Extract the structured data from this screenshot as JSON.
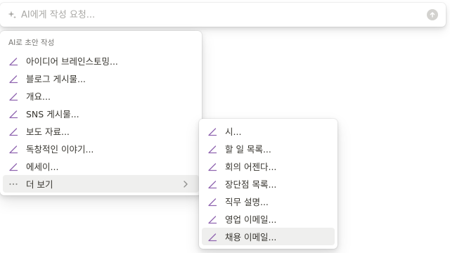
{
  "ai_bar": {
    "placeholder": "AI에게 작성 요청..."
  },
  "main_menu": {
    "section_title": "AI로 초안 작성",
    "items": [
      {
        "label": "아이디어 브레인스토밍..."
      },
      {
        "label": "블로그 게시물..."
      },
      {
        "label": "개요..."
      },
      {
        "label": "SNS 게시물..."
      },
      {
        "label": "보도 자료..."
      },
      {
        "label": "독창적인 이야기..."
      },
      {
        "label": "에세이..."
      }
    ],
    "more": {
      "label": "더 보기"
    }
  },
  "sub_menu": {
    "items": [
      {
        "label": "시..."
      },
      {
        "label": "할 일 목록..."
      },
      {
        "label": "회의 어젠다..."
      },
      {
        "label": "장단점 목록..."
      },
      {
        "label": "직무 설명..."
      },
      {
        "label": "영업 이메일..."
      },
      {
        "label": "채용 이메일..."
      }
    ]
  },
  "colors": {
    "accent_purple": "#9065b0",
    "text": "#37352f",
    "muted": "#787774",
    "hover_bg": "#efefee"
  },
  "icons": {
    "prompt": "sparkle-icon",
    "send": "arrow-up-icon",
    "draft_item": "pen-icon",
    "more": "ellipsis-icon",
    "submenu": "chevron-right-icon"
  }
}
